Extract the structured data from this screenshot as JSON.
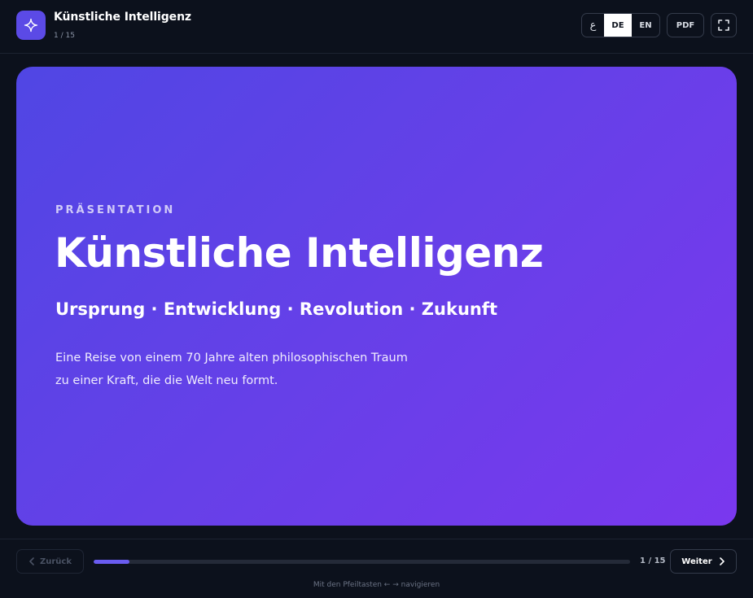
{
  "header": {
    "title": "Künstliche Intelligenz",
    "slide_counter": "1 / 15",
    "languages": {
      "ar": "ع",
      "de": "DE",
      "en": "EN",
      "active": "DE"
    },
    "pdf_label": "PDF"
  },
  "slide": {
    "kicker": "PRÄSENTATION",
    "title": "Künstliche Intelligenz",
    "subtitle": "Ursprung · Entwicklung · Revolution · Zukunft",
    "description": "Eine Reise von einem 70 Jahre alten philosophischen Traum zu einer Kraft, die die Welt neu formt."
  },
  "footer": {
    "back_label": "Zurück",
    "next_label": "Weiter",
    "slide_counter": "1 / 15",
    "progress_fraction": 0.0667,
    "hint": "Mit den Pfeiltasten ← → navigieren"
  },
  "colors": {
    "background": "#0c111c",
    "accent": "#5b4ae6",
    "slide_gradient_start": "#5046e4",
    "slide_gradient_end": "#7a38ee"
  },
  "icons": {
    "app": "sparkle-icon",
    "fullscreen": "fullscreen-icon",
    "back": "chevron-left-icon",
    "next": "chevron-right-icon"
  }
}
